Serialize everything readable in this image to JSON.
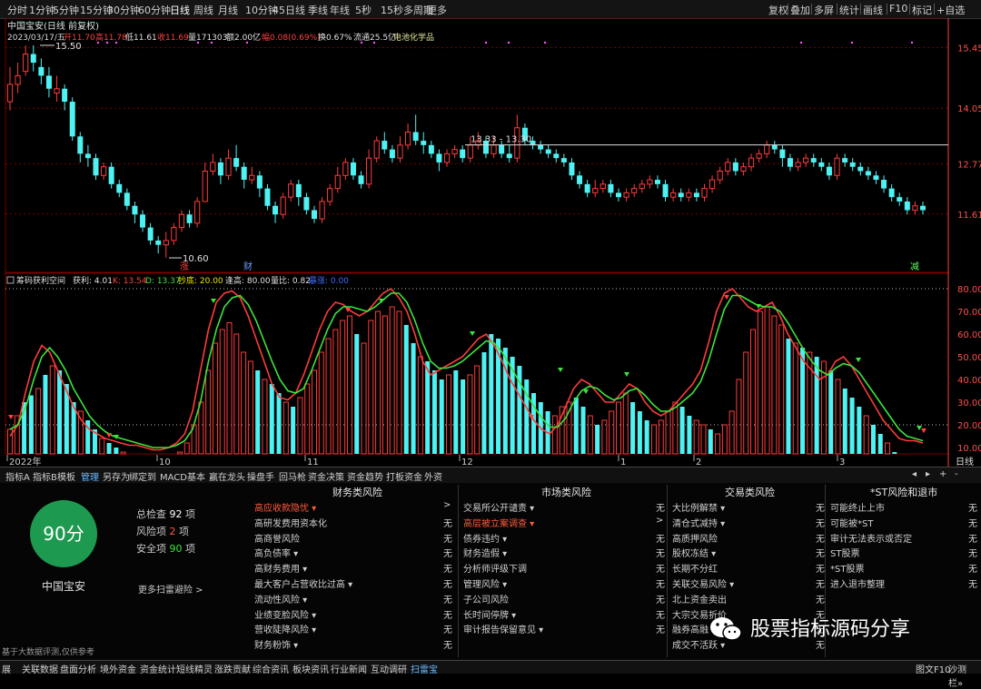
{
  "colors": {
    "up": "#ff3b3b",
    "down": "#4ef2f2",
    "ma": "#f2f2f2",
    "k": "#ff3b3b",
    "d": "#3ce43c",
    "grid": "#7a0000",
    "axis": "#ff4040",
    "accent": "#6ab8ff",
    "highlight": "#ff5a3c",
    "score": "#1e9a50"
  },
  "period_bar": {
    "items": [
      "分时",
      "1分钟",
      "5分钟",
      "15分钟",
      "30分钟",
      "60分钟",
      "日线",
      "周线",
      "月线",
      "10分钟",
      "45日线",
      "季线",
      "年线",
      "5秒",
      "15秒",
      "多周期",
      "更多"
    ],
    "active": "日线",
    "right_items": [
      "复权",
      "叠加",
      "多屏",
      "统计",
      "画线",
      "F10",
      "标记",
      "+自选"
    ]
  },
  "stock_info": {
    "title": "中国宝安(日线 前复权)",
    "date": "2023/03/17/五",
    "open": "开11.70",
    "high": "高11.78",
    "low": "低11.61",
    "close": "收11.69",
    "volume": "量171303",
    "amount": "额2.00亿",
    "change": "幅0.08(0.69%)",
    "turnover": "换0.67%",
    "float_cap": "流通25.5亿",
    "sector": "电池化学品"
  },
  "price_axis": [
    "15.45",
    "14.05",
    "12.77",
    "11.61"
  ],
  "price_annotations": {
    "high_label": "15.50",
    "low_label": "10.60",
    "range_label": "13.33 - 13.30",
    "marker_1": "涨",
    "marker_2": "财",
    "marker_3": "减"
  },
  "indicator_info": {
    "name": "筹码获利空间",
    "profit": "获利: 4.01",
    "k": "K: 13.54",
    "d": "D: 13.37",
    "shaopan": "抄底: 20.00",
    "fengxian": "逢高: 80.00",
    "vratio": "量比: 0.82",
    "extra": "暴涨: 0.00"
  },
  "indicator_axis": [
    "80.00",
    "70.00",
    "60.00",
    "50.00",
    "40.00",
    "30.00",
    "20.00",
    "10.00"
  ],
  "time_axis": [
    "2022年",
    "10",
    "11",
    "12",
    "1",
    "2",
    "3"
  ],
  "time_axis_right": "日线",
  "chart_tabs": [
    "指标A",
    "指标B",
    "模板",
    "管理",
    "另存为",
    "绑定到",
    "MACD基本",
    "赢在龙头",
    "操盘手",
    "回马枪",
    "资金决策",
    "资金趋势",
    "打板资金",
    "外资"
  ],
  "active_chart_tab": "管理",
  "scroll_controls": [
    "◂",
    "▸",
    "+",
    "-"
  ],
  "score": {
    "value": "90分",
    "stock": "中国宝安",
    "total": "总检查",
    "total_val": "92",
    "risk": "风险项",
    "risk_val": "2",
    "safe": "安全项",
    "safe_val": "90",
    "unit": "项",
    "more": "更多扫雷避险 >",
    "disclaimer": "基于大数据评测,仅供参考"
  },
  "risk_columns": [
    {
      "title": "财务类风险",
      "rows": [
        {
          "label": "高应收款隐忧 ▾",
          "status": ">",
          "hl": true
        },
        {
          "label": "高研发费用资本化",
          "status": "无"
        },
        {
          "label": "高商誉风险",
          "status": "无"
        },
        {
          "label": "高负债率 ▾",
          "status": "无"
        },
        {
          "label": "高财务费用 ▾",
          "status": "无"
        },
        {
          "label": "最大客户占营收比过高 ▾",
          "status": "无"
        },
        {
          "label": "流动性风险 ▾",
          "status": "无"
        },
        {
          "label": "业绩变脸风险 ▾",
          "status": "无"
        },
        {
          "label": "营收陡降风险 ▾",
          "status": "无"
        },
        {
          "label": "财务粉饰 ▾",
          "status": "无"
        }
      ]
    },
    {
      "title": "市场类风险",
      "rows": [
        {
          "label": "交易所公开谴责 ▾",
          "status": "无"
        },
        {
          "label": "高层被立案调查 ▾",
          "status": ">",
          "hl": true
        },
        {
          "label": "债券违约 ▾",
          "status": "无"
        },
        {
          "label": "财务造假 ▾",
          "status": "无"
        },
        {
          "label": "分析师评级下调",
          "status": "无"
        },
        {
          "label": "管理风险 ▾",
          "status": "无"
        },
        {
          "label": "子公司风险",
          "status": "无"
        },
        {
          "label": "长时间停牌 ▾",
          "status": "无"
        },
        {
          "label": "审计报告保留意见 ▾",
          "status": "无"
        }
      ]
    },
    {
      "title": "交易类风险",
      "rows": [
        {
          "label": "大比例解禁 ▾",
          "status": "无"
        },
        {
          "label": "清仓式减持 ▾",
          "status": "无"
        },
        {
          "label": "高质押风险",
          "status": "无"
        },
        {
          "label": "股权冻结 ▾",
          "status": "无"
        },
        {
          "label": "长期不分红",
          "status": "无"
        },
        {
          "label": "关联交易风险 ▾",
          "status": "无"
        },
        {
          "label": "北上资金卖出",
          "status": "无"
        },
        {
          "label": "大宗交易折价",
          "status": "无"
        },
        {
          "label": "融券高融",
          "status": "无"
        },
        {
          "label": "成交不活跃 ▾",
          "status": "无"
        }
      ]
    },
    {
      "title": "*ST风险和退市",
      "rows": [
        {
          "label": "可能终止上市",
          "status": "无"
        },
        {
          "label": "可能被*ST",
          "status": "无"
        },
        {
          "label": "审计无法表示或否定",
          "status": "无"
        },
        {
          "label": "ST股票",
          "status": "无"
        },
        {
          "label": "*ST股票",
          "status": "无"
        },
        {
          "label": "进入退市整理",
          "status": "无"
        }
      ]
    }
  ],
  "bottom_tabs": [
    "展",
    "关联数据",
    "盘面分析",
    "境外资金",
    "资金统计",
    "短线精灵",
    "涨跌贡献",
    "综合资讯",
    "板块资讯",
    "行业新闻",
    "互动调研",
    "扫雷宝"
  ],
  "active_bottom_tab": "扫雷宝",
  "bottom_right": [
    "图文F10",
    "沙测栏»"
  ],
  "watermark": "股票指标源码分享",
  "candles": [
    [
      14.2,
      14.6,
      15.0,
      14.0
    ],
    [
      14.6,
      14.8,
      15.1,
      14.4
    ],
    [
      14.9,
      15.3,
      15.5,
      14.8
    ],
    [
      15.3,
      15.1,
      15.5,
      14.9
    ],
    [
      15.0,
      14.8,
      15.2,
      14.6
    ],
    [
      14.8,
      14.5,
      15.0,
      14.3
    ],
    [
      14.4,
      14.5,
      14.8,
      14.2
    ],
    [
      14.5,
      14.2,
      14.6,
      14.0
    ],
    [
      14.2,
      13.4,
      14.3,
      13.3
    ],
    [
      13.4,
      13.0,
      13.5,
      12.8
    ],
    [
      13.0,
      12.9,
      13.2,
      12.7
    ],
    [
      12.9,
      12.5,
      13.0,
      12.4
    ],
    [
      12.5,
      12.7,
      12.8,
      12.4
    ],
    [
      12.7,
      12.3,
      12.8,
      12.2
    ],
    [
      12.3,
      12.1,
      12.4,
      12.0
    ],
    [
      12.1,
      11.8,
      12.2,
      11.7
    ],
    [
      11.8,
      11.6,
      11.9,
      11.4
    ],
    [
      11.6,
      11.3,
      11.7,
      11.2
    ],
    [
      11.3,
      11.0,
      11.4,
      10.9
    ],
    [
      11.0,
      10.9,
      11.1,
      10.7
    ],
    [
      10.9,
      11.0,
      11.2,
      10.6
    ],
    [
      11.0,
      11.3,
      11.4,
      10.9
    ],
    [
      11.3,
      11.6,
      11.7,
      11.2
    ],
    [
      11.6,
      11.4,
      11.7,
      11.3
    ],
    [
      11.4,
      11.9,
      12.0,
      11.3
    ],
    [
      11.9,
      12.6,
      12.8,
      11.9
    ],
    [
      12.6,
      12.8,
      13.0,
      12.5
    ],
    [
      12.8,
      12.5,
      12.9,
      12.3
    ],
    [
      12.5,
      12.9,
      13.1,
      12.4
    ],
    [
      12.9,
      12.7,
      13.2,
      12.6
    ],
    [
      12.7,
      12.4,
      12.8,
      12.2
    ],
    [
      12.4,
      12.5,
      12.7,
      12.3
    ],
    [
      12.5,
      12.2,
      12.6,
      12.0
    ],
    [
      12.2,
      11.8,
      12.3,
      11.7
    ],
    [
      11.8,
      11.6,
      11.9,
      11.4
    ],
    [
      11.6,
      12.0,
      12.1,
      11.5
    ],
    [
      12.0,
      12.3,
      12.4,
      11.9
    ],
    [
      12.3,
      12.0,
      12.4,
      11.8
    ],
    [
      12.0,
      11.7,
      12.1,
      11.6
    ],
    [
      11.7,
      11.5,
      11.8,
      11.4
    ],
    [
      11.5,
      11.9,
      12.0,
      11.4
    ],
    [
      11.9,
      12.2,
      12.3,
      11.8
    ],
    [
      12.2,
      12.5,
      12.7,
      12.1
    ],
    [
      12.5,
      12.8,
      12.9,
      12.4
    ],
    [
      12.8,
      12.5,
      12.9,
      12.4
    ],
    [
      12.5,
      12.3,
      12.6,
      12.2
    ],
    [
      12.3,
      12.9,
      13.1,
      12.2
    ],
    [
      12.9,
      13.3,
      13.4,
      12.8
    ],
    [
      13.3,
      13.1,
      13.5,
      13.0
    ],
    [
      13.1,
      12.9,
      13.2,
      12.8
    ],
    [
      12.9,
      13.2,
      13.4,
      12.8
    ],
    [
      13.2,
      13.5,
      13.7,
      13.1
    ],
    [
      13.5,
      13.3,
      13.9,
      13.2
    ],
    [
      13.3,
      13.2,
      13.5,
      13.0
    ],
    [
      13.2,
      13.0,
      13.3,
      12.9
    ],
    [
      13.0,
      12.8,
      13.1,
      12.6
    ],
    [
      12.8,
      13.0,
      13.1,
      12.7
    ],
    [
      13.0,
      13.1,
      13.2,
      12.9
    ],
    [
      13.1,
      12.9,
      13.2,
      12.8
    ],
    [
      12.9,
      13.2,
      13.4,
      12.8
    ],
    [
      13.2,
      13.3,
      13.5,
      13.1
    ],
    [
      13.3,
      13.0,
      13.4,
      12.9
    ],
    [
      13.0,
      13.2,
      13.4,
      12.9
    ],
    [
      13.2,
      13.0,
      13.3,
      12.9
    ],
    [
      13.0,
      12.9,
      13.2,
      12.8
    ],
    [
      12.9,
      13.6,
      13.9,
      12.8
    ],
    [
      13.6,
      13.3,
      13.7,
      13.2
    ],
    [
      13.3,
      13.2,
      13.4,
      13.1
    ],
    [
      13.2,
      13.1,
      13.3,
      13.0
    ],
    [
      13.1,
      13.0,
      13.2,
      12.9
    ],
    [
      13.0,
      12.9,
      13.1,
      12.8
    ],
    [
      12.9,
      12.8,
      13.0,
      12.7
    ],
    [
      12.8,
      12.5,
      12.9,
      12.4
    ],
    [
      12.5,
      12.3,
      12.6,
      12.2
    ],
    [
      12.3,
      12.1,
      12.4,
      12.0
    ],
    [
      12.1,
      12.2,
      12.4,
      12.0
    ],
    [
      12.2,
      12.3,
      12.4,
      12.1
    ],
    [
      12.3,
      12.1,
      12.4,
      12.0
    ],
    [
      12.1,
      12.0,
      12.2,
      11.9
    ],
    [
      12.0,
      12.1,
      12.2,
      11.9
    ],
    [
      12.1,
      12.2,
      12.3,
      12.0
    ],
    [
      12.2,
      12.3,
      12.4,
      12.1
    ],
    [
      12.3,
      12.4,
      12.5,
      12.2
    ],
    [
      12.4,
      12.3,
      12.5,
      12.2
    ],
    [
      12.3,
      12.0,
      12.4,
      11.9
    ],
    [
      12.0,
      12.1,
      12.2,
      11.9
    ],
    [
      12.1,
      12.0,
      12.2,
      11.9
    ],
    [
      12.0,
      12.1,
      12.2,
      11.9
    ],
    [
      12.1,
      12.0,
      12.2,
      11.9
    ],
    [
      12.0,
      12.2,
      12.3,
      11.9
    ],
    [
      12.2,
      12.4,
      12.5,
      12.1
    ],
    [
      12.4,
      12.6,
      12.7,
      12.3
    ],
    [
      12.6,
      12.8,
      12.9,
      12.5
    ],
    [
      12.8,
      12.6,
      12.9,
      12.5
    ],
    [
      12.6,
      12.7,
      12.8,
      12.5
    ],
    [
      12.7,
      12.9,
      13.0,
      12.6
    ],
    [
      12.9,
      13.0,
      13.1,
      12.8
    ],
    [
      13.0,
      13.2,
      13.3,
      12.9
    ],
    [
      13.2,
      13.1,
      13.3,
      13.0
    ],
    [
      13.1,
      12.9,
      13.2,
      12.7
    ],
    [
      12.9,
      12.7,
      13.0,
      12.6
    ],
    [
      12.7,
      12.8,
      12.9,
      12.6
    ],
    [
      12.8,
      12.9,
      13.0,
      12.7
    ],
    [
      12.9,
      12.8,
      13.0,
      12.7
    ],
    [
      12.8,
      12.7,
      12.9,
      12.6
    ],
    [
      12.7,
      12.5,
      12.8,
      12.4
    ],
    [
      12.5,
      12.9,
      13.0,
      12.4
    ],
    [
      12.9,
      12.8,
      13.0,
      12.7
    ],
    [
      12.8,
      12.7,
      12.9,
      12.6
    ],
    [
      12.7,
      12.6,
      12.8,
      12.5
    ],
    [
      12.6,
      12.5,
      12.7,
      12.4
    ],
    [
      12.5,
      12.4,
      12.6,
      12.3
    ],
    [
      12.4,
      12.2,
      12.5,
      12.1
    ],
    [
      12.2,
      12.0,
      12.3,
      11.9
    ],
    [
      12.0,
      11.9,
      12.1,
      11.8
    ],
    [
      11.9,
      11.7,
      12.0,
      11.6
    ],
    [
      11.7,
      11.8,
      11.9,
      11.6
    ],
    [
      11.8,
      11.7,
      11.9,
      11.6
    ]
  ],
  "volume_bars": [
    [
      18,
      1
    ],
    [
      24,
      1
    ],
    [
      30,
      0
    ],
    [
      33,
      0
    ],
    [
      36,
      1
    ],
    [
      42,
      0
    ],
    [
      46,
      1
    ],
    [
      44,
      0
    ],
    [
      38,
      0
    ],
    [
      30,
      0
    ],
    [
      26,
      1
    ],
    [
      22,
      0
    ],
    [
      18,
      0
    ],
    [
      14,
      1
    ],
    [
      12,
      0
    ],
    [
      10,
      0
    ],
    [
      8,
      1
    ],
    [
      6,
      0
    ],
    [
      5,
      1
    ],
    [
      5,
      0
    ],
    [
      5,
      1
    ],
    [
      6,
      1
    ],
    [
      5,
      0
    ],
    [
      6,
      1
    ],
    [
      8,
      1
    ],
    [
      12,
      1
    ],
    [
      20,
      1
    ],
    [
      30,
      1
    ],
    [
      44,
      1
    ],
    [
      56,
      1
    ],
    [
      62,
      1
    ],
    [
      65,
      1
    ],
    [
      60,
      1
    ],
    [
      52,
      1
    ],
    [
      48,
      1
    ],
    [
      44,
      0
    ],
    [
      40,
      1
    ],
    [
      38,
      0
    ],
    [
      34,
      0
    ],
    [
      30,
      1
    ],
    [
      28,
      0
    ],
    [
      32,
      1
    ],
    [
      38,
      1
    ],
    [
      44,
      1
    ],
    [
      52,
      1
    ],
    [
      58,
      1
    ],
    [
      62,
      1
    ],
    [
      66,
      1
    ],
    [
      68,
      1
    ],
    [
      60,
      0
    ],
    [
      56,
      1
    ],
    [
      66,
      1
    ],
    [
      70,
      1
    ],
    [
      68,
      1
    ],
    [
      72,
      1
    ],
    [
      70,
      1
    ],
    [
      64,
      0
    ],
    [
      56,
      0
    ],
    [
      50,
      1
    ],
    [
      48,
      0
    ],
    [
      44,
      0
    ],
    [
      40,
      0
    ],
    [
      42,
      1
    ],
    [
      44,
      0
    ],
    [
      40,
      0
    ],
    [
      42,
      1
    ],
    [
      46,
      1
    ],
    [
      52,
      0
    ],
    [
      60,
      0
    ],
    [
      58,
      0
    ],
    [
      54,
      0
    ],
    [
      50,
      0
    ],
    [
      46,
      0
    ],
    [
      40,
      0
    ],
    [
      34,
      0
    ],
    [
      30,
      0
    ],
    [
      26,
      0
    ],
    [
      24,
      1
    ],
    [
      28,
      1
    ],
    [
      30,
      1
    ],
    [
      32,
      0
    ],
    [
      28,
      0
    ],
    [
      24,
      1
    ],
    [
      20,
      0
    ],
    [
      22,
      1
    ],
    [
      26,
      1
    ],
    [
      30,
      1
    ],
    [
      34,
      1
    ],
    [
      30,
      0
    ],
    [
      26,
      0
    ],
    [
      22,
      0
    ],
    [
      20,
      1
    ],
    [
      22,
      1
    ],
    [
      26,
      1
    ],
    [
      30,
      1
    ],
    [
      28,
      0
    ],
    [
      24,
      0
    ],
    [
      22,
      1
    ],
    [
      20,
      1
    ],
    [
      18,
      0
    ],
    [
      16,
      1
    ],
    [
      20,
      1
    ],
    [
      26,
      1
    ],
    [
      40,
      1
    ],
    [
      52,
      1
    ],
    [
      62,
      1
    ],
    [
      70,
      1
    ],
    [
      72,
      1
    ],
    [
      68,
      1
    ],
    [
      64,
      1
    ],
    [
      58,
      0
    ],
    [
      56,
      1
    ],
    [
      54,
      0
    ],
    [
      52,
      1
    ],
    [
      50,
      0
    ],
    [
      48,
      1
    ],
    [
      44,
      0
    ],
    [
      40,
      1
    ],
    [
      36,
      0
    ],
    [
      32,
      0
    ],
    [
      28,
      0
    ],
    [
      24,
      1
    ],
    [
      20,
      0
    ],
    [
      16,
      0
    ],
    [
      12,
      1
    ],
    [
      8,
      0
    ],
    [
      6,
      0
    ],
    [
      5,
      0
    ],
    [
      5,
      1
    ],
    [
      6,
      0
    ]
  ],
  "kd_lines": {
    "k": [
      15,
      20,
      35,
      48,
      55,
      52,
      44,
      36,
      28,
      22,
      18,
      16,
      14,
      13,
      12,
      11,
      11,
      10,
      9,
      9,
      10,
      12,
      16,
      26,
      44,
      62,
      74,
      78,
      79,
      76,
      68,
      58,
      48,
      38,
      32,
      31,
      34,
      42,
      52,
      62,
      70,
      74,
      73,
      70,
      68,
      70,
      74,
      78,
      80,
      76,
      70,
      60,
      48,
      42,
      44,
      46,
      48,
      50,
      54,
      58,
      60,
      55,
      48,
      40,
      34,
      28,
      22,
      18,
      16,
      20,
      28,
      36,
      40,
      38,
      34,
      30,
      30,
      34,
      38,
      36,
      30,
      26,
      24,
      26,
      30,
      34,
      38,
      44,
      56,
      70,
      78,
      80,
      76,
      72,
      70,
      72,
      74,
      68,
      60,
      54,
      48,
      44,
      40,
      42,
      48,
      50,
      46,
      40,
      34,
      28,
      22,
      18,
      14,
      13,
      13,
      12
    ],
    "d": [
      18,
      20,
      28,
      40,
      50,
      54,
      50,
      44,
      36,
      30,
      24,
      20,
      17,
      15,
      14,
      13,
      12,
      11,
      10,
      10,
      10,
      11,
      13,
      18,
      30,
      48,
      62,
      72,
      76,
      77,
      73,
      66,
      57,
      48,
      40,
      35,
      34,
      36,
      44,
      53,
      62,
      69,
      72,
      72,
      71,
      70,
      72,
      75,
      78,
      78,
      74,
      66,
      56,
      48,
      45,
      45,
      46,
      48,
      51,
      54,
      57,
      56,
      52,
      46,
      40,
      34,
      28,
      23,
      19,
      19,
      23,
      30,
      35,
      37,
      36,
      33,
      31,
      32,
      35,
      36,
      33,
      29,
      26,
      26,
      28,
      31,
      34,
      39,
      48,
      60,
      71,
      77,
      77,
      75,
      73,
      72,
      72,
      70,
      65,
      59,
      53,
      48,
      44,
      42,
      45,
      47,
      46,
      43,
      38,
      33,
      28,
      23,
      18,
      15,
      14,
      13
    ]
  }
}
